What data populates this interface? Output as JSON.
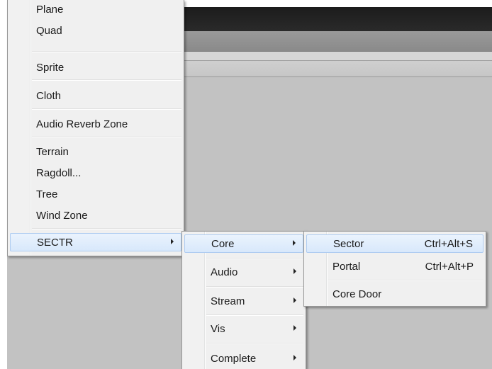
{
  "main_menu": {
    "items": [
      {
        "label": "Plane"
      },
      {
        "label": "Quad"
      },
      {
        "label": "Sprite"
      },
      {
        "label": "Cloth"
      },
      {
        "label": "Audio Reverb Zone"
      },
      {
        "label": "Terrain"
      },
      {
        "label": "Ragdoll..."
      },
      {
        "label": "Tree"
      },
      {
        "label": "Wind Zone"
      },
      {
        "label": "SECTR",
        "submenu": true,
        "highlighted": true
      }
    ]
  },
  "sectr_menu": {
    "items": [
      {
        "label": "Core",
        "submenu": true,
        "highlighted": true
      },
      {
        "label": "Audio",
        "submenu": true
      },
      {
        "label": "Stream",
        "submenu": true
      },
      {
        "label": "Vis",
        "submenu": true
      },
      {
        "label": "Complete",
        "submenu": true
      }
    ]
  },
  "core_menu": {
    "items": [
      {
        "label": "Sector",
        "shortcut": "Ctrl+Alt+S",
        "highlighted": true
      },
      {
        "label": "Portal",
        "shortcut": "Ctrl+Alt+P"
      },
      {
        "label": "Core Door"
      }
    ]
  },
  "icons": {
    "submenu_arrow": "chevron-right-icon"
  }
}
